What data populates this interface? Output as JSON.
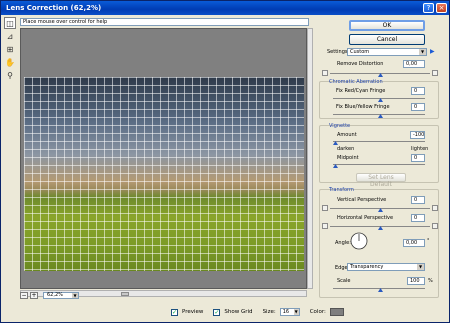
{
  "window": {
    "title": "Lens Correction (62,2%)"
  },
  "hint": "Place mouse over control for help",
  "zoom": {
    "value": "62,2%",
    "minus": "−",
    "plus": "+"
  },
  "bottom": {
    "preview_label": "Preview",
    "grid_label": "Show Grid",
    "size_label": "Size:",
    "size_value": "16",
    "color_label": "Color:"
  },
  "buttons": {
    "ok": "OK",
    "cancel": "Cancel"
  },
  "settings": {
    "label": "Settings:",
    "value": "Custom"
  },
  "remove_distortion": {
    "label": "Remove Distortion",
    "value": "0,00"
  },
  "chromatic": {
    "title": "Chromatic Aberration",
    "red_cyan_label": "Fix Red/Cyan Fringe",
    "red_cyan_value": "0",
    "blue_yellow_label": "Fix Blue/Yellow Fringe",
    "blue_yellow_value": "0"
  },
  "vignette": {
    "title": "Vignette",
    "amount_label": "Amount",
    "amount_value": "-100",
    "darken": "darken",
    "lighten": "lighten",
    "midpoint_label": "Midpoint",
    "midpoint_value": "0",
    "set_default": "Set Lens Default"
  },
  "transform": {
    "title": "Transform",
    "vertical_label": "Vertical Perspective",
    "vertical_value": "0",
    "horizontal_label": "Horizontal Perspective",
    "horizontal_value": "0",
    "angle_label": "Angle:",
    "angle_value": "0,00",
    "angle_unit": "°",
    "edge_label": "Edge:",
    "edge_value": "Transparency",
    "scale_label": "Scale",
    "scale_value": "100",
    "scale_unit": "%"
  }
}
